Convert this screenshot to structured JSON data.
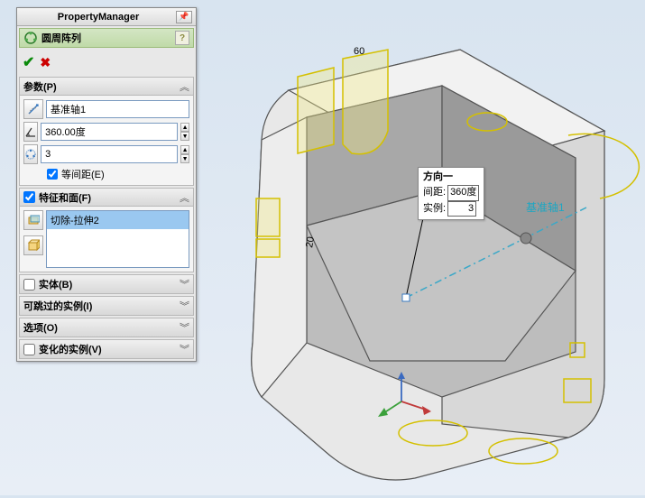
{
  "panel": {
    "title": "PropertyManager",
    "feature_name": "圆周阵列",
    "help": "?",
    "ok": "✔",
    "cancel": "✖"
  },
  "sections": {
    "params": {
      "title": "参数(P)",
      "axis_value": "基准轴1",
      "angle_value": "360.00度",
      "count_value": "3",
      "equal_spacing": "等间距(E)"
    },
    "features": {
      "title": "特征和面(F)",
      "item": "切除-拉伸2"
    },
    "bodies": {
      "title": "实体(B)"
    },
    "skip": {
      "title": "可跳过的实例(I)"
    },
    "options": {
      "title": "选项(O)"
    },
    "varied": {
      "title": "变化的实例(V)"
    }
  },
  "callout": {
    "header": "方向一",
    "spacing_label": "间距:",
    "spacing_value": "360度",
    "instances_label": "实例:",
    "instances_value": "3"
  },
  "viewport": {
    "axis_label": "基准轴1"
  }
}
